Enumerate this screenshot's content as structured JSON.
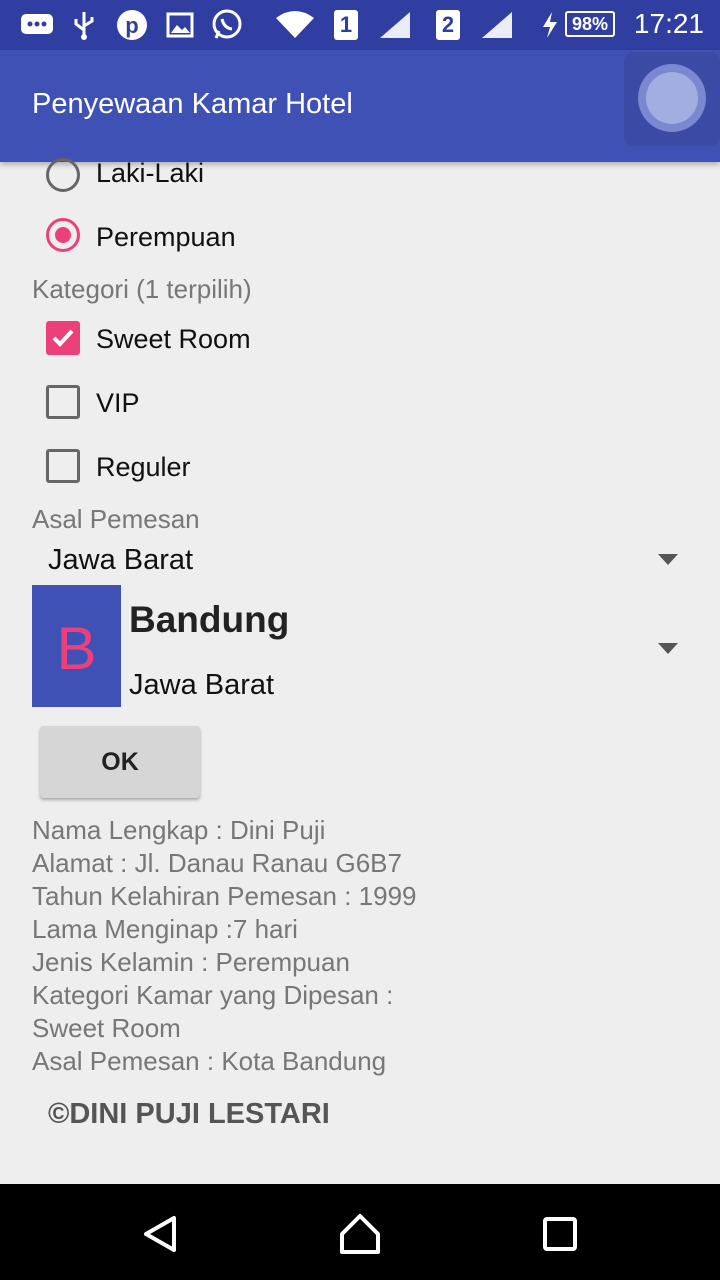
{
  "status_bar": {
    "time": "17:21",
    "battery": "98%",
    "sim1": "1",
    "sim2": "2",
    "icons": [
      "chat-icon",
      "usb-icon",
      "pinterest-icon",
      "image-icon",
      "whatsapp-icon",
      "wifi-icon",
      "signal-icon",
      "signal-icon",
      "charging-icon",
      "battery-icon"
    ]
  },
  "app_bar": {
    "title": "Penyewaan Kamar Hotel"
  },
  "gender": {
    "options": [
      {
        "label": "Laki-Laki",
        "checked": false
      },
      {
        "label": "Perempuan",
        "checked": true
      }
    ]
  },
  "category": {
    "label": "Kategori (1 terpilih)",
    "options": [
      {
        "label": "Sweet Room",
        "checked": true
      },
      {
        "label": "VIP",
        "checked": false
      },
      {
        "label": "Reguler",
        "checked": false
      }
    ]
  },
  "origin": {
    "label": "Asal Pemesan",
    "province_selected": "Jawa Barat",
    "city": {
      "avatar_letter": "B",
      "name": "Bandung",
      "province": "Jawa Barat"
    }
  },
  "ok_button": "OK",
  "summary": [
    "Nama Lengkap : Dini Puji",
    "Alamat : Jl. Danau Ranau G6B7",
    "Tahun Kelahiran Pemesan : 1999",
    "Lama Menginap :7 hari",
    "Jenis Kelamin : Perempuan",
    "Kategori Kamar yang Dipesan :",
    "Sweet Room",
    "Asal Pemesan :  Kota Bandung"
  ],
  "footer": "©DINI PUJI LESTARI",
  "colors": {
    "primary": "#3f51b5",
    "primary_dark": "#2f3ea0",
    "accent": "#ec407a"
  }
}
